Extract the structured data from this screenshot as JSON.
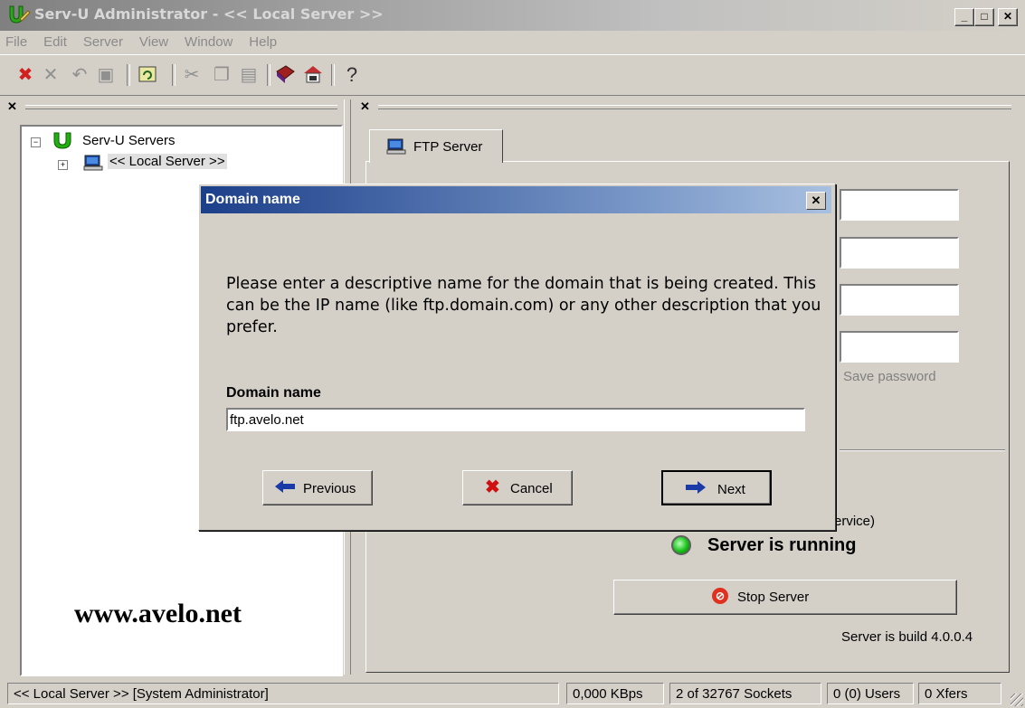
{
  "window": {
    "title": "Serv-U Administrator - << Local Server >>",
    "controls": {
      "minimize": "_",
      "maximize": "□",
      "close": "✕"
    }
  },
  "menu": [
    "File",
    "Edit",
    "Server",
    "View",
    "Window",
    "Help"
  ],
  "toolbar": {
    "icons": [
      "disconnect-icon",
      "delete-icon",
      "undo-icon",
      "save-icon",
      "refresh-icon",
      "cut-icon",
      "copy-icon",
      "paste-icon",
      "help-book-icon",
      "web-icon",
      "about-icon"
    ]
  },
  "tree": {
    "root_label": "Serv-U Servers",
    "child_label": "<< Local Server >>"
  },
  "watermark": "www.avelo.net",
  "tab": {
    "label": "FTP Server"
  },
  "right_panel": {
    "save_password_label": "Save password",
    "service_tail": "ervice)",
    "running_status": "Server is running",
    "stop_button_label": "Stop Server",
    "build_text": "Server is build 4.0.0.4"
  },
  "dialog": {
    "title": "Domain name",
    "close_label": "✕",
    "message": "Please enter a descriptive name for the domain that is being created. This can be the IP name (like ftp.domain.com) or any other description that you prefer.",
    "field_label": "Domain name",
    "field_value": "ftp.avelo.net",
    "buttons": {
      "previous": "Previous",
      "cancel": "Cancel",
      "next": "Next"
    }
  },
  "statusbar": {
    "left": "<< Local Server >>  [System Administrator]",
    "speed": "0,000 KBps",
    "sockets": "2 of 32767 Sockets",
    "users": "0 (0) Users",
    "xfers": "0 Xfers"
  },
  "colors": {
    "dialog_title_start": "#1c3f8a",
    "running_indicator": "#18c018",
    "stop_icon": "#e03020"
  }
}
